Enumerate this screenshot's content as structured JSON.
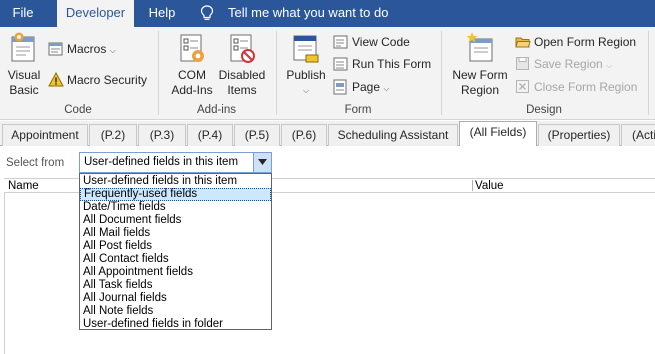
{
  "ribbon_tabs": {
    "file": "File",
    "developer": "Developer",
    "help": "Help",
    "tell_me": "Tell me what you want to do"
  },
  "code_group": {
    "label": "Code",
    "visual_basic_line1": "Visual",
    "visual_basic_line2": "Basic",
    "macros": "Macros",
    "macro_security": "Macro Security"
  },
  "addins_group": {
    "label": "Add-ins",
    "com_addins_line1": "COM",
    "com_addins_line2": "Add-Ins",
    "disabled_items_line1": "Disabled",
    "disabled_items_line2": "Items"
  },
  "form_group": {
    "label": "Form",
    "publish": "Publish",
    "view_code": "View Code",
    "run_this_form": "Run This Form",
    "page": "Page"
  },
  "design_group": {
    "label": "Design",
    "new_form_region_line1": "New Form",
    "new_form_region_line2": "Region",
    "open_form_region": "Open Form Region",
    "save_region": "Save Region",
    "close_form_region": "Close Form Region"
  },
  "page_tabs": [
    "Appointment",
    "(P.2)",
    "(P.3)",
    "(P.4)",
    "(P.5)",
    "(P.6)",
    "Scheduling Assistant",
    "(All Fields)",
    "(Properties)",
    "(Acti"
  ],
  "active_page_tab": "(All Fields)",
  "select_from": {
    "label": "Select from",
    "value": "User-defined fields in this item"
  },
  "fields_table": {
    "col_name": "Name",
    "col_value": "Value"
  },
  "dropdown_options": [
    "User-defined fields in this item",
    "Frequently-used fields",
    "Date/Time fields",
    "All Document fields",
    "All Mail fields",
    "All Post fields",
    "All Contact fields",
    "All Appointment fields",
    "All Task fields",
    "All Journal fields",
    "All Note fields",
    "User-defined fields in folder"
  ],
  "highlighted_option": "Frequently-used fields",
  "colors": {
    "ribbon_blue": "#2b579a",
    "ribbon_bg": "#f3f3f3",
    "selection_bg": "#cce8ff",
    "combo_border": "#7a9fd4"
  },
  "icons": [
    "lightbulb-icon",
    "visual-basic-icon",
    "macros-icon",
    "macro-security-icon",
    "com-addins-icon",
    "disabled-items-icon",
    "publish-icon",
    "view-code-icon",
    "run-form-icon",
    "page-icon",
    "new-form-region-icon",
    "open-folder-icon",
    "save-icon",
    "close-region-icon",
    "dropdown-arrow-icon"
  ]
}
